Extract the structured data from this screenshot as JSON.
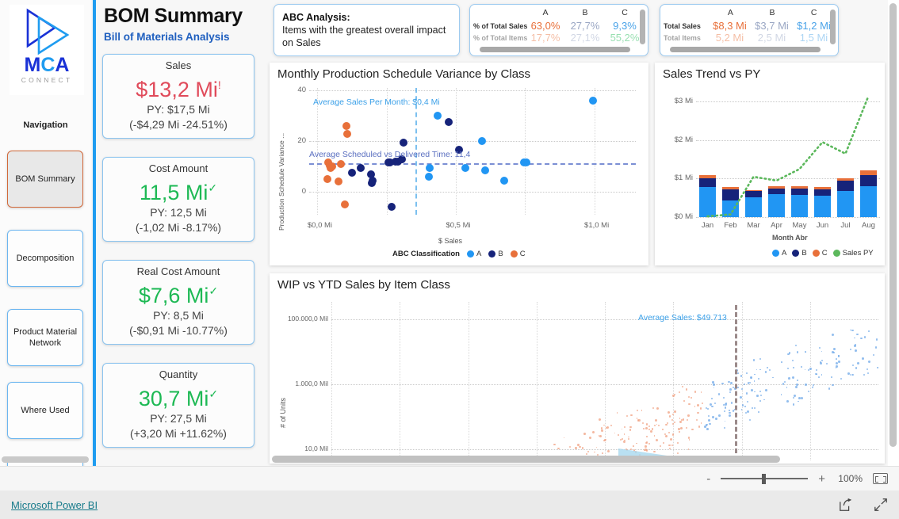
{
  "brand": {
    "logo_primary": "MCA",
    "logo_sub": "CONNECT",
    "nav_heading": "Navigation",
    "color_blue": "#1a32d6",
    "color_cyan": "#1f9cf0"
  },
  "sidebar": {
    "items": [
      {
        "label": "BOM Summary",
        "active": true
      },
      {
        "label": "Decomposition",
        "active": false
      },
      {
        "label": "Product Material Network",
        "active": false
      },
      {
        "label": "Where Used",
        "active": false
      }
    ]
  },
  "header": {
    "title": "BOM Summary",
    "subtitle": "Bill of Materials Analysis"
  },
  "kpis": [
    {
      "label": "Sales",
      "value": "$13,2 Mi",
      "flag": "!",
      "state": "red",
      "py": "PY: $17,5 Mi",
      "delta": "(-$4,29 Mi -24.51%)"
    },
    {
      "label": "Cost Amount",
      "value": "11,5 Mi",
      "flag": "✓",
      "state": "green",
      "py": "PY: 12,5 Mi",
      "delta": "(-1,02 Mi -8.17%)"
    },
    {
      "label": "Real Cost Amount",
      "value": "$7,6 Mi",
      "flag": "✓",
      "state": "green",
      "py": "PY: 8,5 Mi",
      "delta": "(-$0,91 Mi -10.77%)"
    },
    {
      "label": "Quantity",
      "value": "30,7 Mi",
      "flag": "✓",
      "state": "green",
      "py": "PY: 27,5 Mi",
      "delta": "(+3,20 Mi +11.62%)"
    }
  ],
  "abc_card": {
    "title": "ABC Analysis:",
    "description": "Items with the greatest overall impact on Sales"
  },
  "pct_table": {
    "columns": [
      "A",
      "B",
      "C"
    ],
    "rows": [
      {
        "label": "% of Total Sales",
        "values": [
          "63,0%",
          "27,7%",
          "9,3%"
        ],
        "colors": [
          "#e8703a",
          "#9aa7c4",
          "#4aa3e8"
        ]
      },
      {
        "label": "% of Total Items",
        "values": [
          "17,7%",
          "27,1%",
          "55,2%"
        ],
        "colors": [
          "#e8703a",
          "#9aa7c4",
          "#1db954"
        ]
      }
    ]
  },
  "total_table": {
    "columns": [
      "A",
      "B",
      "C"
    ],
    "rows": [
      {
        "label": "Total Sales",
        "values": [
          "$8,3 Mi",
          "$3,7 Mi",
          "$1,2 Mi"
        ],
        "colors": [
          "#e8703a",
          "#9aa7c4",
          "#4aa3e8"
        ]
      },
      {
        "label": "Total Items",
        "values": [
          "5,2 Mi",
          "2,5 Mi",
          "1,5 Mi"
        ],
        "colors": [
          "#e8703a",
          "#9aa7c4",
          "#4aa3e8"
        ]
      }
    ]
  },
  "chart_data": [
    {
      "id": "scatter",
      "type": "scatter",
      "title": "Monthly Production Schedule Variance by Class",
      "xlabel": "$ Sales",
      "ylabel": "Production Schedule Variance ...",
      "xticks": [
        "$0,0 Mi",
        "$0,5 Mi",
        "$1,0 Mi"
      ],
      "xtickvals": [
        0,
        0.5,
        1.0
      ],
      "yticks": [
        "0",
        "20",
        "40"
      ],
      "ytickvals": [
        0,
        20,
        40
      ],
      "xlim": [
        -0.03,
        1.15
      ],
      "ylim": [
        -9,
        41
      ],
      "grid": true,
      "legend_title": "ABC Classification",
      "legend": [
        {
          "name": "A",
          "color": "#2196F3"
        },
        {
          "name": "B",
          "color": "#16237a"
        },
        {
          "name": "C",
          "color": "#e8703a"
        }
      ],
      "annotations": [
        {
          "text": "Average Sales Per Month: $0,4 Mi",
          "color": "#3ba0e8",
          "type": "vline",
          "value": 0.355
        },
        {
          "text": "Average Scheduled vs Delivered Time: 11,4",
          "color": "#5a6fc0",
          "type": "hline",
          "value": 11.4
        }
      ],
      "series": [
        {
          "name": "A",
          "color": "#2196F3",
          "points": [
            [
              0.995,
              36
            ],
            [
              0.435,
              30
            ],
            [
              0.595,
              20
            ],
            [
              0.405,
              9.5
            ],
            [
              0.403,
              6
            ],
            [
              0.533,
              9.5
            ],
            [
              0.605,
              8.5
            ],
            [
              0.675,
              4.5
            ],
            [
              0.745,
              11.5
            ],
            [
              0.755,
              11.5
            ]
          ]
        },
        {
          "name": "B",
          "color": "#16237a",
          "points": [
            [
              0.312,
              19.5
            ],
            [
              0.475,
              27.5
            ],
            [
              0.51,
              16.5
            ],
            [
              0.155,
              9.5
            ],
            [
              0.125,
              7.5
            ],
            [
              0.193,
              7
            ],
            [
              0.196,
              3.5
            ],
            [
              0.198,
              4.5
            ],
            [
              0.255,
              11.5
            ],
            [
              0.263,
              11.5
            ],
            [
              0.283,
              11.8
            ],
            [
              0.29,
              12
            ],
            [
              0.305,
              13
            ],
            [
              0.268,
              -6
            ]
          ]
        },
        {
          "name": "C",
          "color": "#e8703a",
          "points": [
            [
              0.105,
              26
            ],
            [
              0.108,
              23
            ],
            [
              0.038,
              11.5
            ],
            [
              0.045,
              10.5
            ],
            [
              0.048,
              9.5
            ],
            [
              0.052,
              10
            ],
            [
              0.085,
              11
            ],
            [
              0.035,
              5
            ],
            [
              0.075,
              4
            ],
            [
              0.098,
              -5
            ]
          ]
        }
      ]
    },
    {
      "id": "trend",
      "type": "bar",
      "stacked": true,
      "title": "Sales Trend vs PY",
      "xlabel": "Month Abr",
      "ylabel": "",
      "categories": [
        "Jan",
        "Feb",
        "Mar",
        "Apr",
        "May",
        "Jun",
        "Jul",
        "Aug"
      ],
      "yticks": [
        "$0 Mi",
        "$1 Mi",
        "$2 Mi",
        "$3 Mi"
      ],
      "ytickvals": [
        0,
        1,
        2,
        3
      ],
      "ylim": [
        0,
        3.4
      ],
      "grid": true,
      "legend": [
        {
          "name": "A",
          "color": "#2196F3"
        },
        {
          "name": "B",
          "color": "#16237a"
        },
        {
          "name": "C",
          "color": "#e8703a"
        },
        {
          "name": "Sales PY",
          "color": "#5cb85c"
        }
      ],
      "series": [
        {
          "name": "A",
          "color": "#2196F3",
          "values": [
            0.78,
            0.44,
            0.52,
            0.6,
            0.58,
            0.55,
            0.68,
            0.8
          ]
        },
        {
          "name": "B",
          "color": "#16237a",
          "values": [
            0.22,
            0.28,
            0.15,
            0.14,
            0.17,
            0.17,
            0.27,
            0.3
          ]
        },
        {
          "name": "C",
          "color": "#e8703a",
          "values": [
            0.1,
            0.06,
            0.04,
            0.06,
            0.06,
            0.07,
            0.07,
            0.11
          ]
        },
        {
          "name": "Sales PY",
          "color": "#5cb85c",
          "type": "line",
          "style": "dotted",
          "values": [
            0.02,
            0.07,
            1.05,
            0.95,
            1.25,
            1.95,
            1.65,
            3.15
          ]
        }
      ]
    },
    {
      "id": "wip",
      "type": "scatter",
      "title": "WIP vs YTD Sales by Item Class",
      "xlabel": "",
      "ylabel": "# of Units",
      "yticks": [
        "10,0 Mil",
        "1.000,0 Mil",
        "100.000,0 Mil"
      ],
      "log_scale": true,
      "grid": true,
      "annotations": [
        {
          "text": "Average Sales: $49.713",
          "color": "#3ba0e8",
          "type": "vline"
        }
      ],
      "series": [
        {
          "name": "blue-cluster",
          "color": "#6fa8e8"
        },
        {
          "name": "orange-cluster",
          "color": "#f0a080"
        }
      ]
    }
  ],
  "zoombar": {
    "minus": "-",
    "plus": "+",
    "percent": "100%",
    "fit_icon": "fit-to-page-icon"
  },
  "footer": {
    "link": "Microsoft Power BI",
    "share_icon": "share-icon",
    "fullscreen_icon": "fullscreen-icon"
  }
}
